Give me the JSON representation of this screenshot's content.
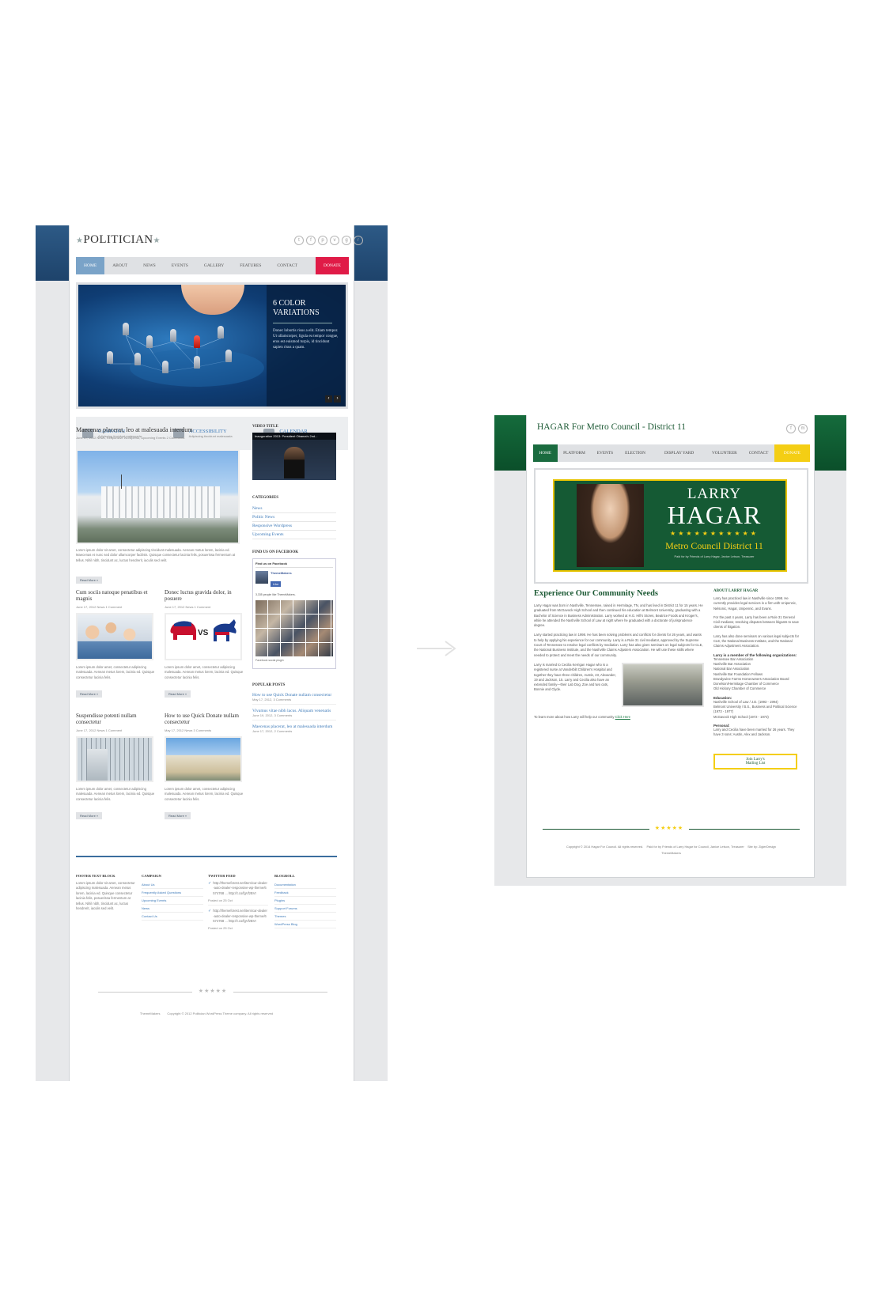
{
  "left": {
    "brand": {
      "name": "POLITICIAN",
      "star": "★"
    },
    "socials": [
      "t",
      "f",
      "p",
      "v",
      "g",
      "r"
    ],
    "nav": {
      "items": [
        "HOME",
        "ABOUT",
        "NEWS",
        "EVENTS",
        "GALLERY",
        "FEATURES",
        "CONTACT"
      ],
      "donate": "DONATE"
    },
    "slider": {
      "heading_line1": "6 COLOR",
      "heading_line2": "VARIATIONS",
      "text": "Donec lobortis risus a elit. Etiam tempor. Ut ullamcorper, ligula eu tempor congue, eros est euismod turpis, id tincidunt sapien risus a quam.",
      "prev": "‹",
      "next": "›"
    },
    "features": [
      {
        "title": "CAMPAIGN",
        "sub": "Adipiscing tincidunt malesuada"
      },
      {
        "title": "ACCESSIBILITY",
        "sub": "Adipiscing tincidunt malesuada"
      },
      {
        "title": "CALENDAR",
        "sub": "Adipiscing tincidunt malesuada"
      }
    ],
    "main_post": {
      "title": "Maecenas placerat, leo at malesuada interdum",
      "meta": "June 17, 2012  News, Responsive Wordpress, Upcoming Events  2 Comments",
      "text": "Lorem ipsum dolor sit amet, consectetur adipiscing tincidunt malesuada. Aenean metus lorem, lacinia ed. Maecenas et nunc sed dolor ullamcorper facilisis. Quisque consectetur lacinia felis, posuerissa fermentum at tellus. Nihil nibh, tincidunt ac, luctus hendrerit, iaculis sed velit.",
      "read_more": "Read More »"
    },
    "posts": [
      {
        "title": "Cum sociis natoque penatibus et magnis",
        "meta": "June 17, 2012  News  1 Comment",
        "text": "Lorem ipsum dolor amet, consectetur adipiscing malesuada. Aenean metus lorem, lacinia ed. Quisque consectetur lacinia felis.",
        "read_more": "Read More »"
      },
      {
        "title": "Donec luctus gravida dolor, in posuere",
        "meta": "June 17, 2012  News  1 Comment",
        "text": "Lorem ipsum dolor amet, consectetur adipiscing malesuada. Aenean metus lorem, lacinia ed. Quisque consectetur lacinia felis.",
        "read_more": "Read More »",
        "vs": "VS"
      },
      {
        "title": "Suspendisse potenti nullam consectetur",
        "meta": "June 17, 2012  News  1 Comment",
        "text": "Lorem ipsum dolor amet, consectetur adipiscing malesuada. Aenean metus lorem, lacinia ed. Quisque consectetur lacinia felis.",
        "read_more": "Read More »"
      },
      {
        "title": "How to use Quick Donate nullam consectetur",
        "meta": "May 17, 2012  News  3 Comments",
        "text": "Lorem ipsum dolor amet, consectetur adipiscing malesuada. Aenean metus lorem, lacinia ed. Quisque consectetur lacinia felis.",
        "read_more": "Read More »"
      }
    ],
    "sidebar": {
      "video_title": "VIDEO TITLE",
      "video_caption": "Inauguration 2013: President Obama's 2nd...",
      "categories_title": "CATEGORIES",
      "categories": [
        "News",
        "Politic News",
        "Responsive Wordpress",
        "Upcoming Events"
      ],
      "facebook_title": "FIND US ON FACEBOOK",
      "fb_header": "Find us on Facebook",
      "fb_name": "ThemeMakers",
      "fb_like": "Like",
      "fb_count": "3,335 people like ThemeMakers.",
      "fb_plugin": "Facebook social plugin",
      "popular_title": "POPULAR POSTS",
      "popular": [
        {
          "title": "How to use Quick Donate nullam consectetur",
          "meta": "May 17, 2012, 3 Comments"
        },
        {
          "title": "Vivamus vitae nibh lacus. Aliquam venenatis",
          "meta": "June 19, 2012, 3 Comments"
        },
        {
          "title": "Maecenas placerat, leo at malesuada interdum",
          "meta": "June 17, 2012, 2 Comments"
        }
      ]
    },
    "footer": {
      "col1_title": "FOOTER TEXT BLOCK",
      "col1_text": "Lorem ipsum dolor sit amet, consectetur adipiscing malesuada. Aenean metus lorem, lacinia ed. Quisque consectetur lacinia felis, posuerissa fermentum at tellus. Nihil nibh, tincidunt ac, luctus hendrerit, iaculis sed velit.",
      "col2_title": "CAMPAIGN",
      "col2_items": [
        "About Us",
        "Frequently Asked Questions",
        "Upcoming Events",
        "News",
        "Contact Us"
      ],
      "col3_title": "TWITTER FEED",
      "tweets": [
        {
          "text": "http://themeforest.net/item/car-dealer-auto-dealer-responsive-wp-theme/6574768 ... http://t.co/fgVfzBVI",
          "posted": "Posted on 25 Oct"
        },
        {
          "text": "http://themeforest.net/item/car-dealer-auto-dealer-responsive-wp-theme/6574768 ... http://t.co/fgVfzBVI",
          "posted": "Posted on 25 Oct"
        }
      ],
      "col4_title": "BLOGROLL",
      "col4_items": [
        "Documentation",
        "Feedback",
        "Plugins",
        "Support Forums",
        "Themes",
        "WordPress Blog"
      ],
      "stars": "★★★★★",
      "copyright": "ThemeMakers        Copyright © 2012 Politician WordPress Theme company. All rights reserved"
    }
  },
  "arrow": {
    "glyph": "→"
  },
  "right": {
    "brand": "HAGAR For Metro Council - District 11",
    "socials": [
      "f",
      "m"
    ],
    "nav": {
      "items": [
        "HOME",
        "PLATFORM",
        "EVENTS",
        "ELECTION INFO",
        "DISPLAY YARD SIGN",
        "VOLUNTEER",
        "CONTACT"
      ],
      "donate": "DONATE"
    },
    "banner": {
      "first": "LARRY",
      "last": "HAGAR",
      "stars": "★★★★★★★★★★★",
      "office": "Metro Council District 11",
      "paid": "Paid for by Friends of Larry Hagar, Janice Letson, Treasurer"
    },
    "main": {
      "title": "Experience Our Community Needs",
      "p1": "Larry Hagar was born in Nashville, Tennessee, raised in Hermitage, TN, and has lived in District 11 for 15 years. He graduated from McGavock High School and then continued his education at Belmont University, graduating with a Bachelor of Science in Business Administration. Larry worked at H.G. Hill's Stores, Beatrice Foods and Kroger's, while he attended the Nashville School of Law at night where he graduated with a doctorate of jurisprudence degree.",
      "p2": "Larry started practicing law in 1998. He has been solving problems and conflicts for clients for 26 years, and wants to help by applying his experience for our community. Larry is a Rule 31 civil mediator, approved by the Supreme Court of Tennessee to resolve legal conflicts by mediation. Larry has also given seminars on legal subjects for CLE, the National Business Institute, and the Nashville Claims Adjusters Association. He will use these skills where needed to protect and meet the needs of our community.",
      "p3": "Larry is married to Cecilia Kerrigan Hagar who is a registered nurse at Vanderbilt Children's Hospital and together they have three children, Austin, 23, Alexander, 19 and Jackson, 15. Larry and Cecilia also have an extended family—their Lab Dog, Zoe and two cats, Bonnie and Clyde.",
      "more": "To learn more about how Larry will help our community",
      "click": "Click Here"
    },
    "sidebar": {
      "title": "ABOUT LARRY HAGAR",
      "p1": "Larry has practiced law in Nashville since 1998. He currently provides legal services in a firm with Unipennic, Nelsonic, Hagar, Unipennic, and Evans.",
      "p2": "For the past 4 years, Larry has been a Rule 31 General Civil mediator, resolving disputes between litigants to save clients of litigation.",
      "p3": "Larry has also done seminars on various legal subjects for CLE, the National Business Institute, and the National Claims Adjustment Association.",
      "orgs_title": "Larry is a member of the following organizations:",
      "orgs": "Tennessee Bar Association\nNashville Bar Association\nNational Bar Association\nNashville Bar Foundation Fellows\nBrandywine Farms Homeowners Association Board\nDonelson/Hermitage Chamber of Commerce\nOld Hickory Chamber of Commerce",
      "edu_title": "Education:",
      "edu": "Nashville School of Law / J.D. (1993 - 1994)\nBelmont University / B.S., Business and Political Science (1973 - 1977)\nMcGavock High School (1972 - 1973)",
      "personal_title": "Personal:",
      "personal": "Larry and Cecilia have been married for 26 years. They have 3 sons: Austin, Alex and Jackson.",
      "mail_line1": "Join Larry's",
      "mail_line2": "Mailing List"
    },
    "footer": {
      "stars": "★★★★★",
      "copyright": "Copyright © 2014 Hagar For Council. All rights reserved.    Paid for by Friends of Larry Hagar for Council, Janice Letson, Treasurer    Site by: ZiglerDesign",
      "credit": "ThemeMakers"
    }
  }
}
